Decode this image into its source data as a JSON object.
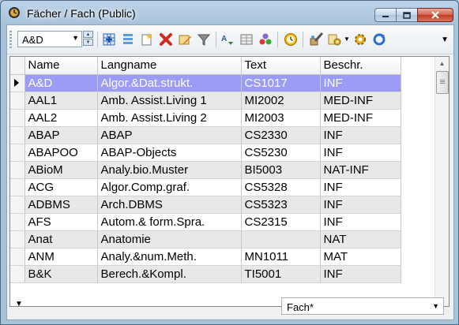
{
  "window": {
    "title": "Fächer / Fach (Public)"
  },
  "toolbar": {
    "selected_subject": "A&D"
  },
  "grid": {
    "columns": [
      "Name",
      "Langname",
      "Text",
      "Beschr."
    ],
    "selected_row": 0,
    "rows": [
      [
        "A&D",
        "Algor.&Dat.strukt.",
        "CS1017",
        "INF"
      ],
      [
        "AAL1",
        "Amb. Assist.Living 1",
        "MI2002",
        "MED-INF"
      ],
      [
        "AAL2",
        "Amb. Assist.Living 2",
        "MI2003",
        "MED-INF"
      ],
      [
        "ABAP",
        "ABAP",
        "CS2330",
        "INF"
      ],
      [
        "ABAPOO",
        "ABAP-Objects",
        "CS5230",
        "INF"
      ],
      [
        "ABioM",
        "Analy.bio.Muster",
        "BI5003",
        "NAT-INF"
      ],
      [
        "ACG",
        "Algor.Comp.graf.",
        "CS5328",
        "INF"
      ],
      [
        "ADBMS",
        "Arch.DBMS",
        "CS5323",
        "INF"
      ],
      [
        "AFS",
        "Autom.& form.Spra.",
        "CS2315",
        "INF"
      ],
      [
        "Anat",
        "Anatomie",
        "",
        "NAT"
      ],
      [
        "ANM",
        "Analy.&num.Meth.",
        "MN1011",
        "MAT"
      ],
      [
        "B&K",
        "Berech.&Kompl.",
        "TI5001",
        "INF"
      ]
    ]
  },
  "statusbar": {
    "filter_value": "Fach*"
  }
}
